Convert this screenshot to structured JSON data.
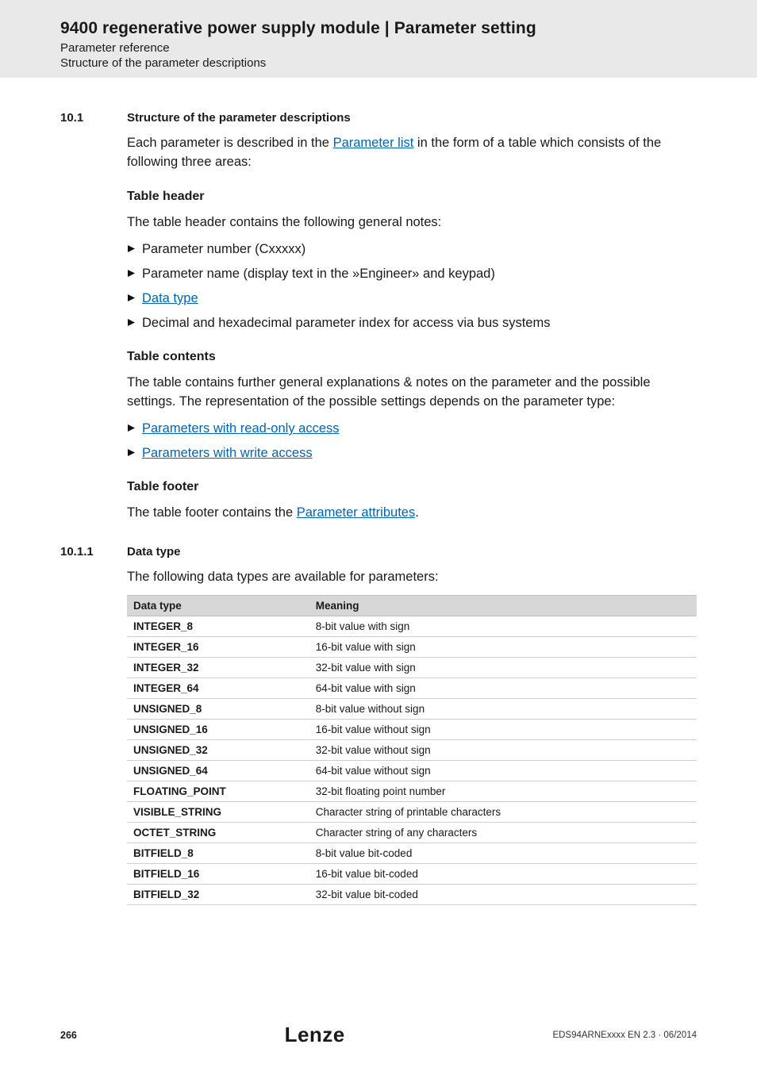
{
  "header": {
    "title": "9400 regenerative power supply module | Parameter setting",
    "sub1": "Parameter reference",
    "sub2": "Structure of the parameter descriptions"
  },
  "sec1": {
    "num": "10.1",
    "title": "Structure of the parameter descriptions",
    "intro_a": "Each parameter is described in the ",
    "intro_link": "Parameter list",
    "intro_b": " in the form of a table which consists of the following three areas:",
    "th_head": "Table header",
    "th_line": "The table header contains the following general notes:",
    "b1": "Parameter number (Cxxxxx)",
    "b2": "Parameter name (display text in the »Engineer» and keypad)",
    "b3": "Data type",
    "b4": "Decimal and hexadecimal parameter index for access via bus systems",
    "tc_head": "Table contents",
    "tc_line": "The table contains further general explanations & notes on the parameter and the possible settings. The representation of the possible settings depends on the parameter type:",
    "tc_l1": "Parameters with read-only access",
    "tc_l2": "Parameters with write access",
    "tf_head": "Table footer",
    "tf_line_a": "The table footer contains the ",
    "tf_link": "Parameter attributes",
    "tf_line_b": "."
  },
  "sec2": {
    "num": "10.1.1",
    "title": "Data type",
    "intro": "The following data types are available for parameters:",
    "col1": "Data type",
    "col2": "Meaning",
    "rows": [
      {
        "dt": "INTEGER_8",
        "m": "8-bit value with sign"
      },
      {
        "dt": "INTEGER_16",
        "m": "16-bit value with sign"
      },
      {
        "dt": "INTEGER_32",
        "m": "32-bit value with sign"
      },
      {
        "dt": "INTEGER_64",
        "m": "64-bit value with sign"
      },
      {
        "dt": "UNSIGNED_8",
        "m": "8-bit value without sign"
      },
      {
        "dt": "UNSIGNED_16",
        "m": "16-bit value without sign"
      },
      {
        "dt": "UNSIGNED_32",
        "m": "32-bit value without sign"
      },
      {
        "dt": "UNSIGNED_64",
        "m": "64-bit value without sign"
      },
      {
        "dt": "FLOATING_POINT",
        "m": "32-bit floating point number"
      },
      {
        "dt": "VISIBLE_STRING",
        "m": "Character string of printable characters"
      },
      {
        "dt": "OCTET_STRING",
        "m": "Character string of any characters"
      },
      {
        "dt": "BITFIELD_8",
        "m": "8-bit value bit-coded"
      },
      {
        "dt": "BITFIELD_16",
        "m": "16-bit value bit-coded"
      },
      {
        "dt": "BITFIELD_32",
        "m": "32-bit value bit-coded"
      }
    ]
  },
  "footer": {
    "page": "266",
    "logo": "Lenze",
    "doc": "EDS94ARNExxxx EN 2.3 · 06/2014"
  }
}
